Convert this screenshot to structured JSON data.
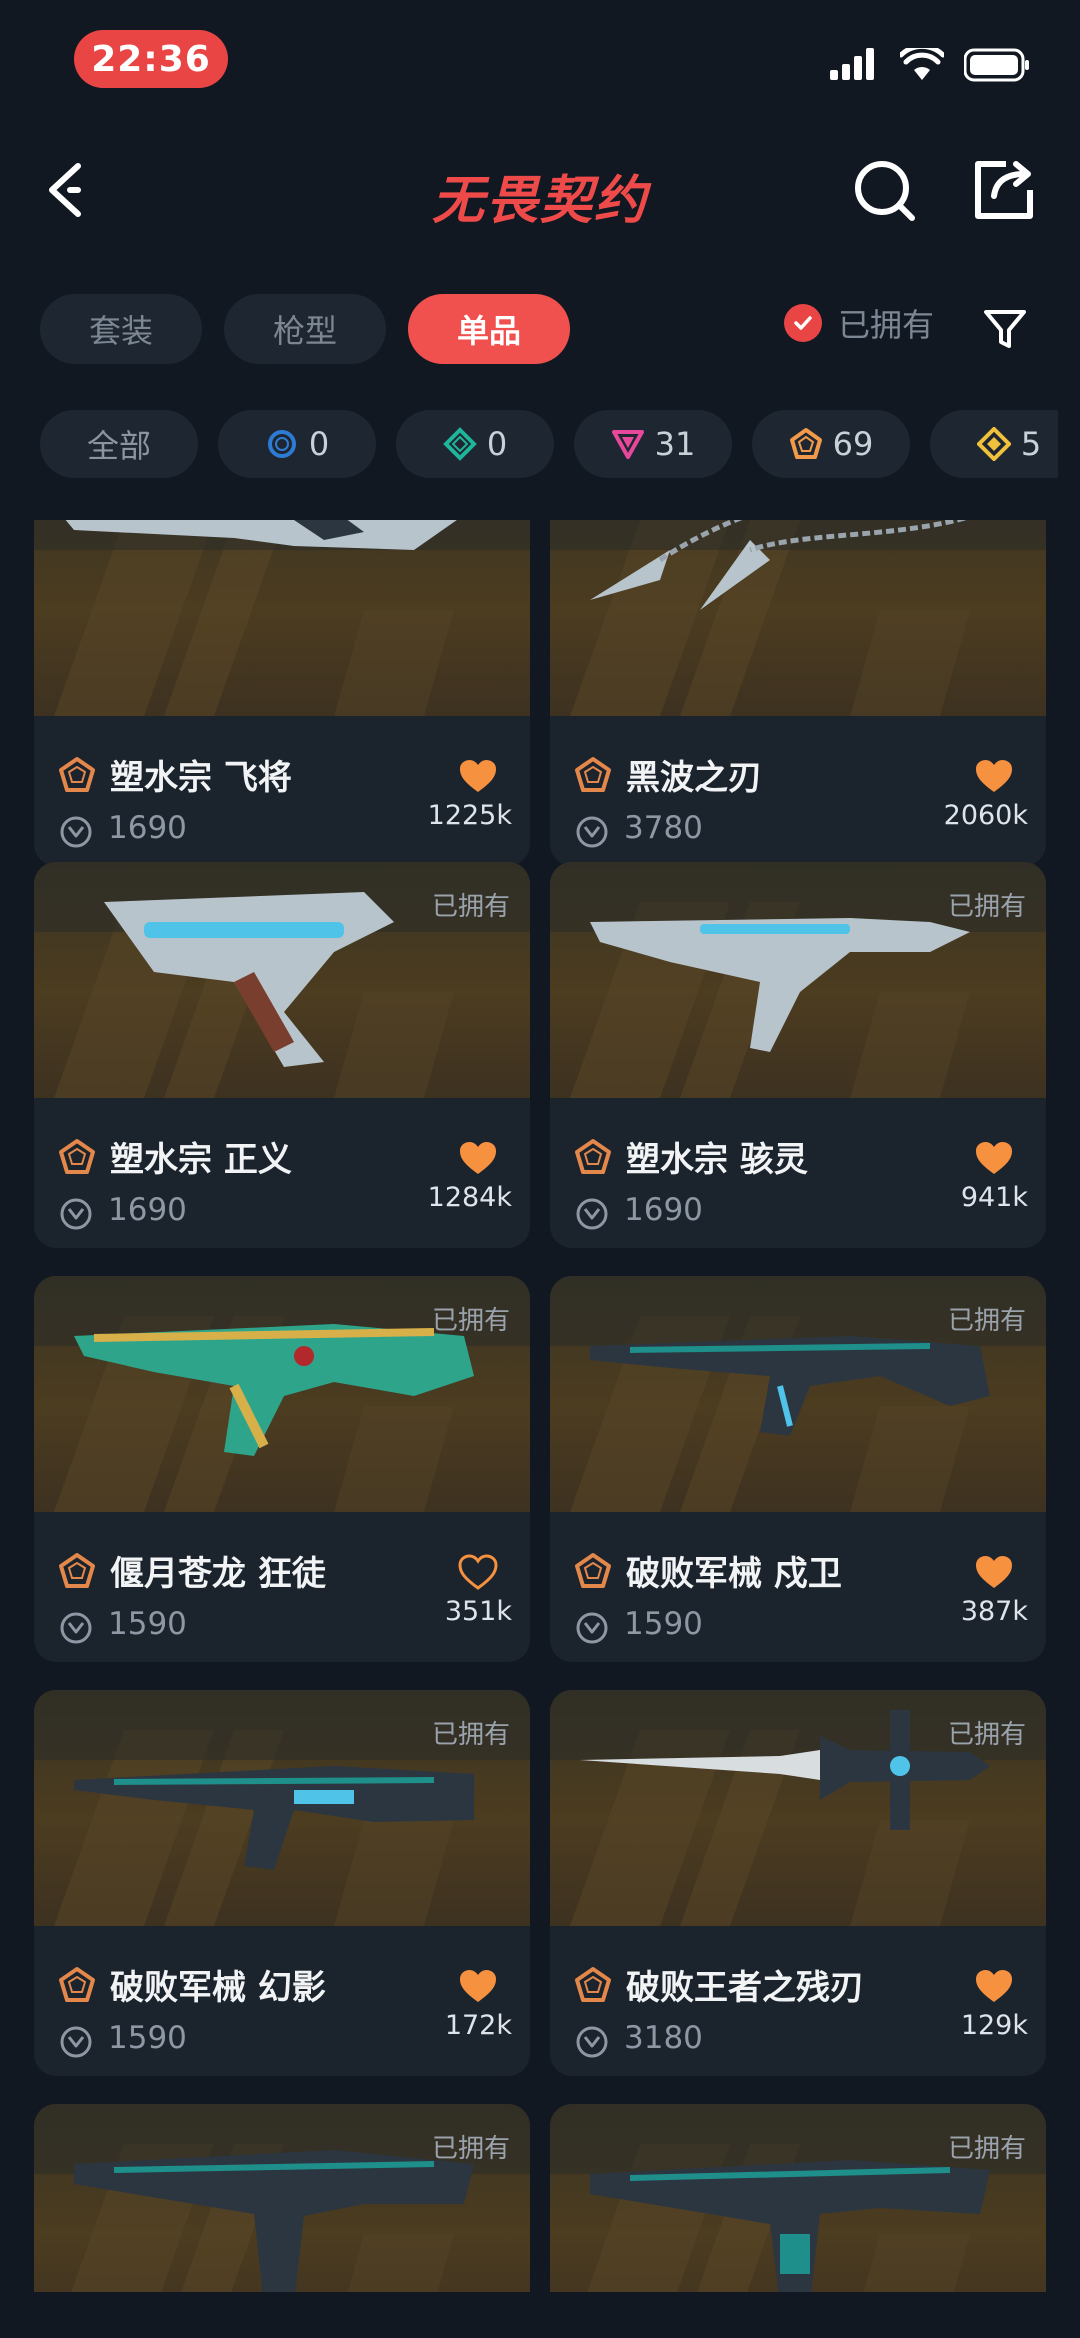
{
  "status_bar": {
    "time": "22:36"
  },
  "header": {
    "title": "无畏契约"
  },
  "tabs": [
    "套装",
    "枪型",
    "单品"
  ],
  "active_tab": 2,
  "owned_toggle": {
    "label": "已拥有",
    "checked": true
  },
  "rarity_filters": [
    {
      "label": "全部"
    },
    {
      "icon": "ring-blue-icon",
      "count": "0",
      "color": "#2e7bd6"
    },
    {
      "icon": "diamond-teal-icon",
      "count": "0",
      "color": "#1fb59b"
    },
    {
      "icon": "triangle-pink-icon",
      "count": "31",
      "color": "#e8489b"
    },
    {
      "icon": "pentagon-orange-icon",
      "count": "69",
      "color": "#f29a4a"
    },
    {
      "icon": "diamond-yellow-icon",
      "count": "5",
      "color": "#f0c23c"
    }
  ],
  "items": [
    {
      "name": "塑水宗 飞将",
      "price": "1690",
      "likes": "1225k",
      "owned": "",
      "liked": true
    },
    {
      "name": "黑波之刃",
      "price": "3780",
      "likes": "2060k",
      "owned": "",
      "liked": true
    },
    {
      "name": "塑水宗 正义",
      "price": "1690",
      "likes": "1284k",
      "owned": "已拥有",
      "liked": true
    },
    {
      "name": "塑水宗 骇灵",
      "price": "1690",
      "likes": "941k",
      "owned": "已拥有",
      "liked": true
    },
    {
      "name": "偃月苍龙 狂徒",
      "price": "1590",
      "likes": "351k",
      "owned": "已拥有",
      "liked": false
    },
    {
      "name": "破败军械 戍卫",
      "price": "1590",
      "likes": "387k",
      "owned": "已拥有",
      "liked": true
    },
    {
      "name": "破败军械 幻影",
      "price": "1590",
      "likes": "172k",
      "owned": "已拥有",
      "liked": true
    },
    {
      "name": "破败王者之残刃",
      "price": "3180",
      "likes": "129k",
      "owned": "已拥有",
      "liked": true
    },
    {
      "name": "",
      "price": "",
      "likes": "",
      "owned": "已拥有",
      "liked": false
    },
    {
      "name": "",
      "price": "",
      "likes": "",
      "owned": "已拥有",
      "liked": false
    }
  ],
  "colors": {
    "accent": "#f0514e",
    "heart": "#f6913f",
    "tier": "#e3884a"
  }
}
